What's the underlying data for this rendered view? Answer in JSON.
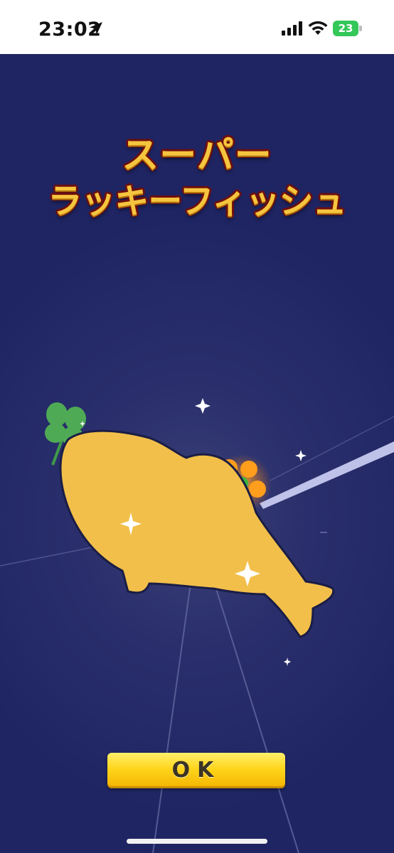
{
  "status_bar": {
    "time": "23:02",
    "battery_level": "23",
    "icons": [
      "location-arrow-icon",
      "cellular-signal-icon",
      "wifi-icon",
      "battery-charging-icon"
    ]
  },
  "game": {
    "title_line1": "スーパー",
    "title_line2": "ラッキーフィッシュ",
    "ok_button_label": "OK",
    "fish_name": "super-lucky-fish",
    "decorations": [
      "four-leaf-clover-icon",
      "flower-icon",
      "sparkle-icon"
    ]
  },
  "colors": {
    "background": "#232863",
    "fish": "#f2bf4a",
    "fish_outline": "#1a1d45",
    "title_fill": "#f6c53f",
    "title_outline": "#6d0e0e",
    "button": "#ffd51c",
    "clover": "#4caf50",
    "flower": "#ff9d1c"
  }
}
